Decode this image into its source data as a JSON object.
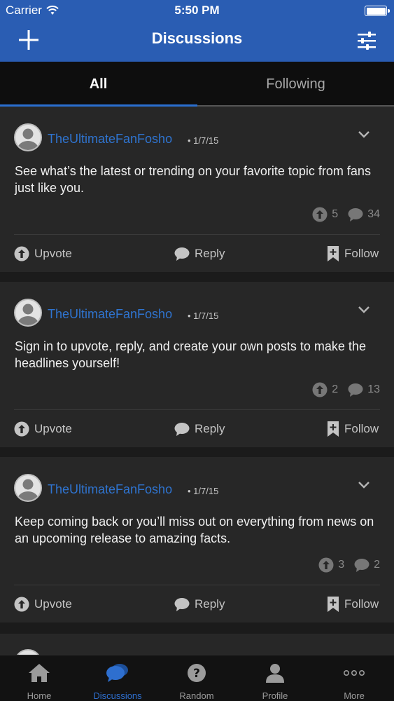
{
  "status_bar": {
    "carrier": "Carrier",
    "time": "5:50 PM",
    "battery_level": 1.0
  },
  "nav": {
    "title": "Discussions",
    "add_icon": "plus-icon",
    "filter_icon": "sliders-icon"
  },
  "tabs": [
    {
      "label": "All",
      "active": true
    },
    {
      "label": "Following",
      "active": false
    }
  ],
  "actions": {
    "upvote": "Upvote",
    "reply": "Reply",
    "follow": "Follow"
  },
  "posts": [
    {
      "author": "TheUltimateFanFosho",
      "date": "1/7/15",
      "text": "See what’s the latest or trending on your favorite topic from fans just like you.",
      "upvotes": "5",
      "replies": "34"
    },
    {
      "author": "TheUltimateFanFosho",
      "date": "1/7/15",
      "text": "Sign in to upvote, reply, and create your own posts to make the headlines yourself!",
      "upvotes": "2",
      "replies": "13"
    },
    {
      "author": "TheUltimateFanFosho",
      "date": "1/7/15",
      "text": "Keep coming back or you’ll miss out on everything from news on an upcoming release to amazing facts.",
      "upvotes": "3",
      "replies": "2"
    }
  ],
  "tabbar": [
    {
      "label": "Home",
      "icon": "home-icon"
    },
    {
      "label": "Discussions",
      "icon": "chat-bubbles-icon",
      "active": true
    },
    {
      "label": "Random",
      "icon": "question-icon"
    },
    {
      "label": "Profile",
      "icon": "person-icon"
    },
    {
      "label": "More",
      "icon": "more-dots-icon"
    }
  ],
  "colors": {
    "header": "#2a5db3",
    "accent": "#2f74d0",
    "card": "#272727",
    "background": "#1b1b1b"
  }
}
